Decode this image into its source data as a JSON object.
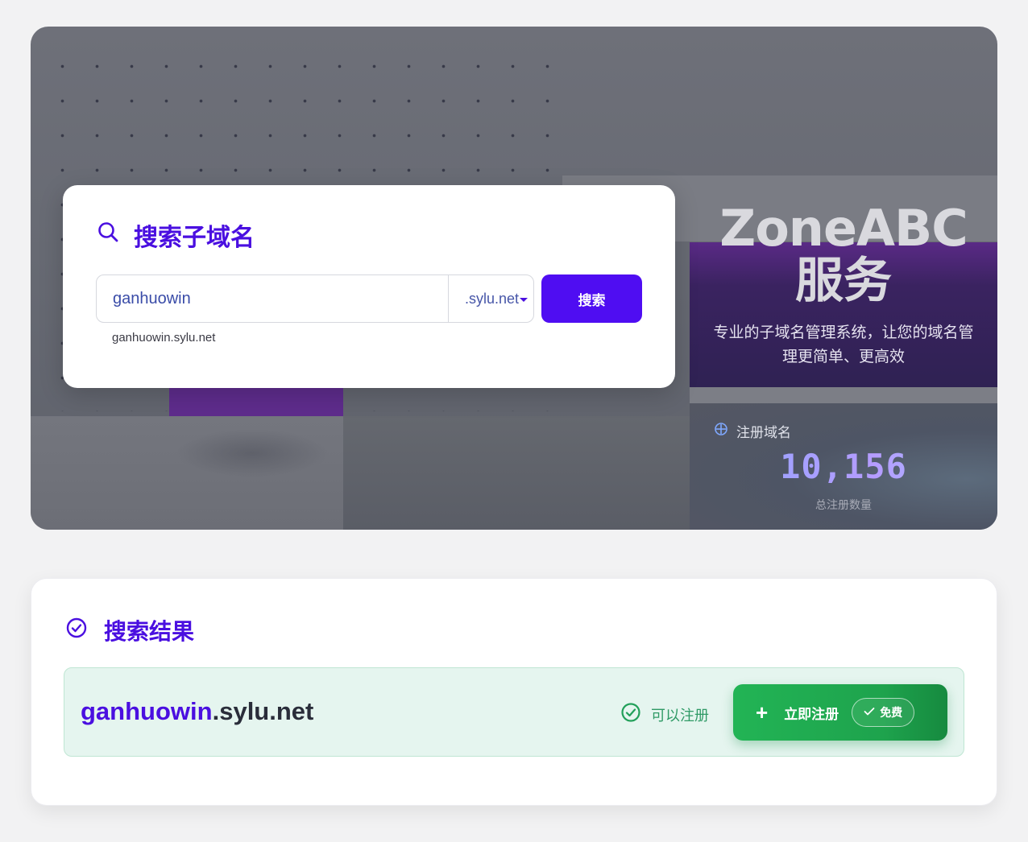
{
  "hero": {
    "brand_line1": "ZoneABC",
    "brand_line2": "服务",
    "tagline": "专业的子域名管理系统，让您的域名管理更简单、更高效",
    "stat": {
      "label": "注册域名",
      "value": "10,156",
      "caption": "总注册数量",
      "icon": "crosshair-icon"
    }
  },
  "search": {
    "title": "搜索子域名",
    "icon": "search-icon",
    "input_value": "ganhuowin",
    "suffix_selected": ".sylu.net",
    "button_label": "搜索",
    "preview": "ganhuowin.sylu.net"
  },
  "result": {
    "title": "搜索结果",
    "icon": "check-circle-icon",
    "subdomain": "ganhuowin",
    "suffix": ".sylu.net",
    "status_text": "可以注册",
    "register_label": "立即注册",
    "free_badge": "免费"
  },
  "colors": {
    "accent": "#4f0df2",
    "success": "#22b455",
    "status_text": "#2f9a66"
  }
}
